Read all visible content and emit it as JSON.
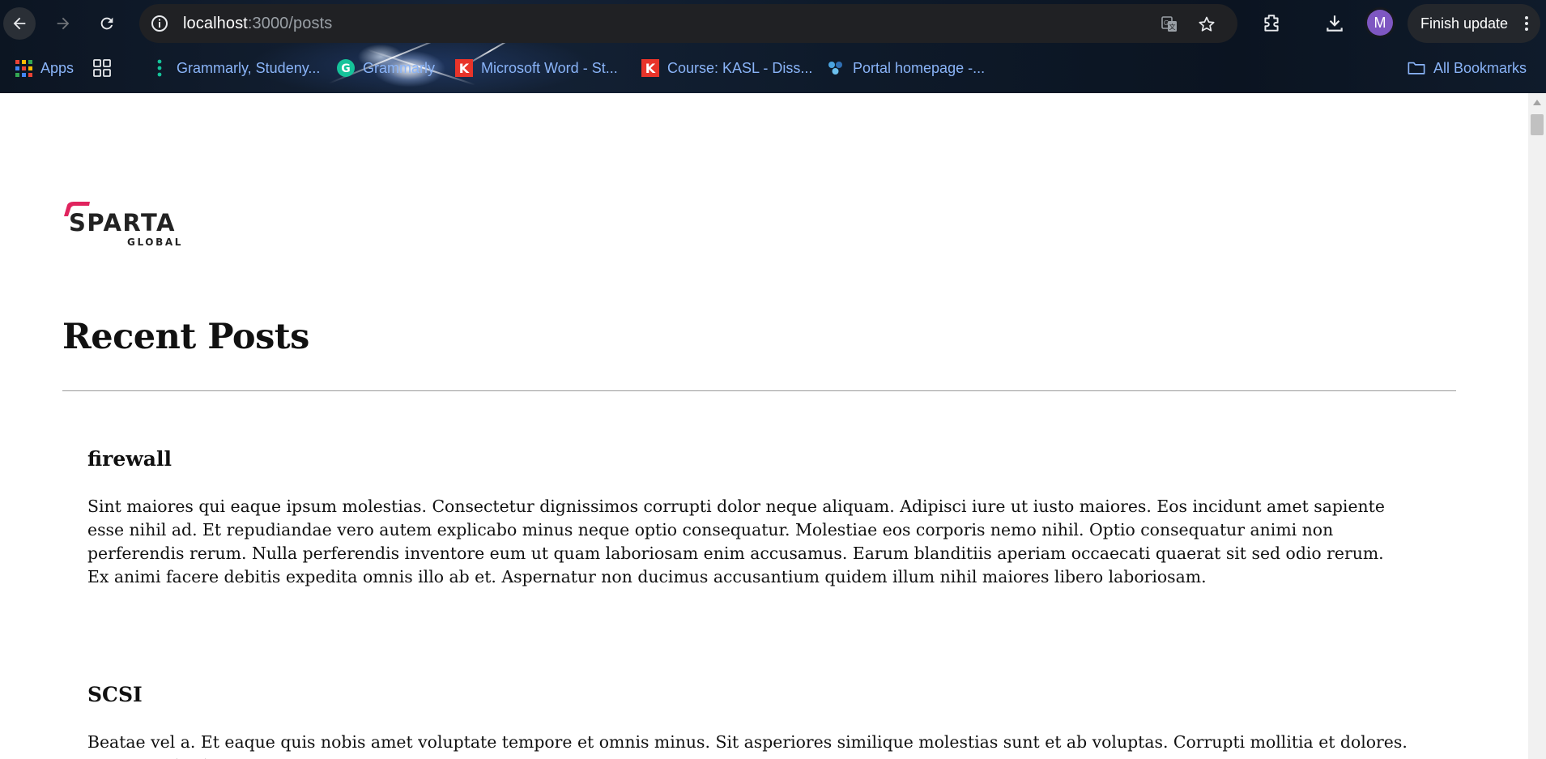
{
  "browser": {
    "url_host": "localhost",
    "url_path": ":3000/posts",
    "profile_initial": "M",
    "finish_update_label": "Finish update",
    "bookmarks": [
      {
        "label": "Apps",
        "icon": "apps-grid-icon"
      },
      {
        "label": "",
        "icon": "tab-groups-icon"
      },
      {
        "label": "Grammarly, Studeny...",
        "icon": "grammarly-dots-icon"
      },
      {
        "label": "Grammarly",
        "icon": "grammarly-icon"
      },
      {
        "label": "Microsoft Word - St...",
        "icon": "k-icon"
      },
      {
        "label": "Course: KASL - Diss...",
        "icon": "k-icon"
      },
      {
        "label": "Portal homepage -...",
        "icon": "portal-icon"
      }
    ],
    "all_bookmarks_label": "All Bookmarks"
  },
  "page": {
    "logo": {
      "line1": "SPARTA",
      "line2": "GLOBAL",
      "accent_color": "#e0245e"
    },
    "heading": "Recent Posts",
    "posts": [
      {
        "title": "firewall",
        "body": "Sint maiores qui eaque ipsum molestias. Consectetur dignissimos corrupti dolor neque aliquam. Adipisci iure ut iusto maiores. Eos incidunt amet sapiente esse nihil ad. Et repudiandae vero autem explicabo minus neque optio consequatur. Molestiae eos corporis nemo nihil. Optio consequatur animi non perferendis rerum. Nulla perferendis inventore eum ut quam laboriosam enim accusamus. Earum blanditiis aperiam occaecati quaerat sit sed odio rerum. Ex animi facere debitis expedita omnis illo ab et. Aspernatur non ducimus accusantium quidem illum nihil maiores libero laboriosam."
      },
      {
        "title": "SCSI",
        "body": "Beatae vel a. Et eaque quis nobis amet voluptate tempore et omnis minus. Sit asperiores similique molestias sunt et ab voluptas. Corrupti mollitia et dolores. Autem veritatis"
      }
    ]
  }
}
